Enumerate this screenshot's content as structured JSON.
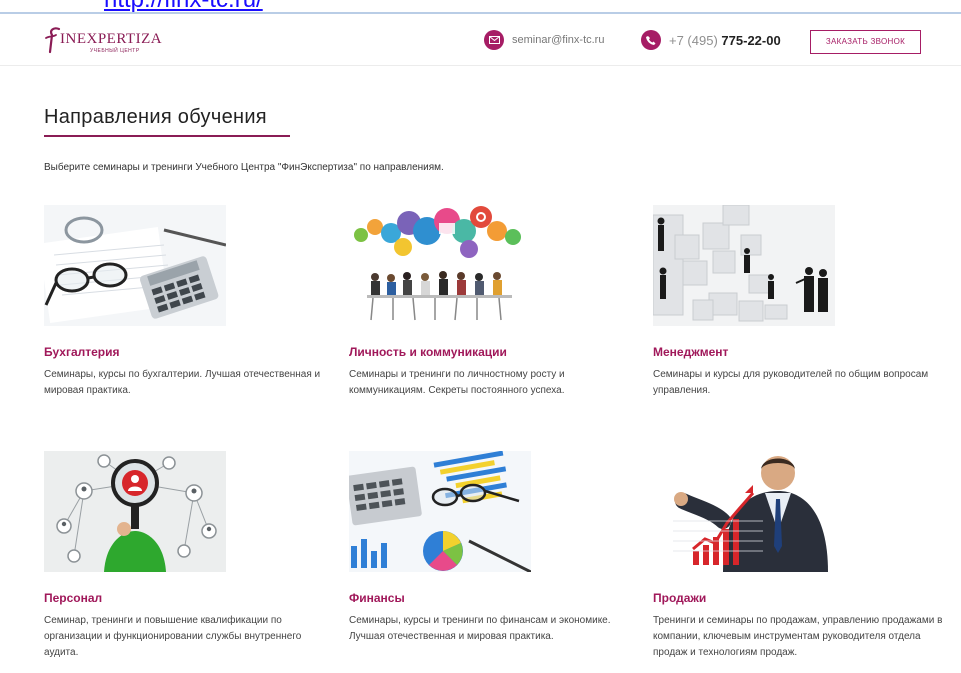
{
  "top_url": "http://finx-tc.ru/",
  "header": {
    "logo_text": "INEXPERTIZA",
    "logo_sub": "УЧЕБНЫЙ ЦЕНТР",
    "email": "seminar@finx-tc.ru",
    "phone_prefix": "+7 (495)",
    "phone_number": "775-22-00",
    "call_button": "ЗАКАЗАТЬ ЗВОНОК"
  },
  "page": {
    "title": "Направления обучения",
    "intro": "Выберите семинары и тренинги Учебного Центра \"ФинЭкспертиза\" по направлениям."
  },
  "directions": [
    {
      "title": "Бухгалтерия",
      "desc": "Семинары, курсы по бухгалтерии. Лучшая отечественная и мировая практика.",
      "image": "accounting-photo"
    },
    {
      "title": "Личность и коммуникации",
      "desc": "Семинары и тренинги по личностному росту и коммуникациям. Секреты постоянного успеха.",
      "image": "communication-photo"
    },
    {
      "title": "Менеджмент",
      "desc": "Семинары и курсы для руководителей по общим вопросам управления.",
      "image": "management-photo"
    },
    {
      "title": "Персонал",
      "desc": "Семинар, тренинги и повышение квалификации по организации и функционировании службы внутреннего аудита.",
      "image": "personnel-photo"
    },
    {
      "title": "Финансы",
      "desc": "Семинары, курсы и тренинги по финансам и экономике. Лучшая отечественная и мировая практика.",
      "image": "finance-photo"
    },
    {
      "title": "Продажи",
      "desc": "Тренинги и семинары по продажам, управлению продажами в компании, ключевым инструментам руководителя отдела продаж и технологиям продаж.",
      "image": "sales-photo"
    }
  ],
  "colors": {
    "accent": "#a61d65",
    "brand": "#8a1c55"
  }
}
